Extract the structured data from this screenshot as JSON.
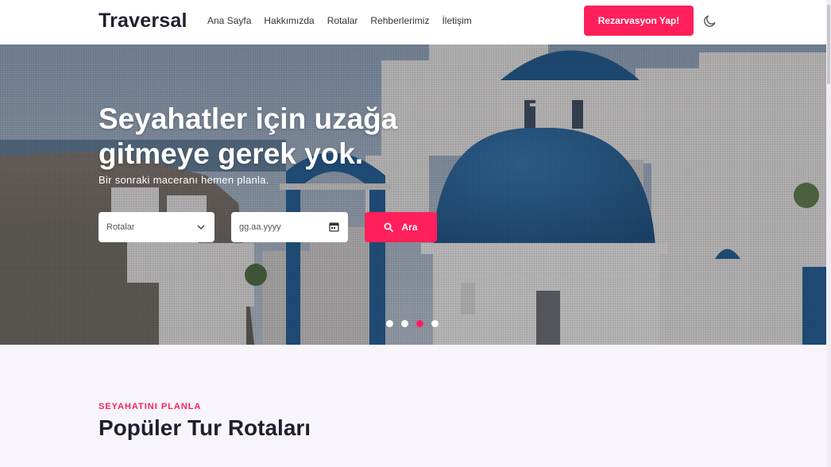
{
  "nav": {
    "logo": "Traversal",
    "items": [
      "Ana Sayfa",
      "Hakkımızda",
      "Rotalar",
      "Rehberlerimiz",
      "İletişim"
    ],
    "cta_label": "Rezarvasyon Yap!",
    "theme_icon": "moon-icon"
  },
  "hero": {
    "title": "Seyahatler için uzağa gitmeye gerek yok.",
    "subtitle": "Bir sonraki maceranı hemen planla.",
    "route_select": {
      "selected": "Rotalar"
    },
    "date_input": {
      "placeholder": "gg.aa.yyyy"
    },
    "search_label": "Ara",
    "slides": {
      "count": 4,
      "active_index": 2
    }
  },
  "section": {
    "eyebrow": "SEYAHATINI PLANLA",
    "title": "Popüler Tur Rotaları"
  },
  "colors": {
    "accent": "#ff1f5a",
    "dark_text": "#1f1f2e",
    "dome_blue": "#1e5f96",
    "page_bg": "#f7f5fb"
  }
}
